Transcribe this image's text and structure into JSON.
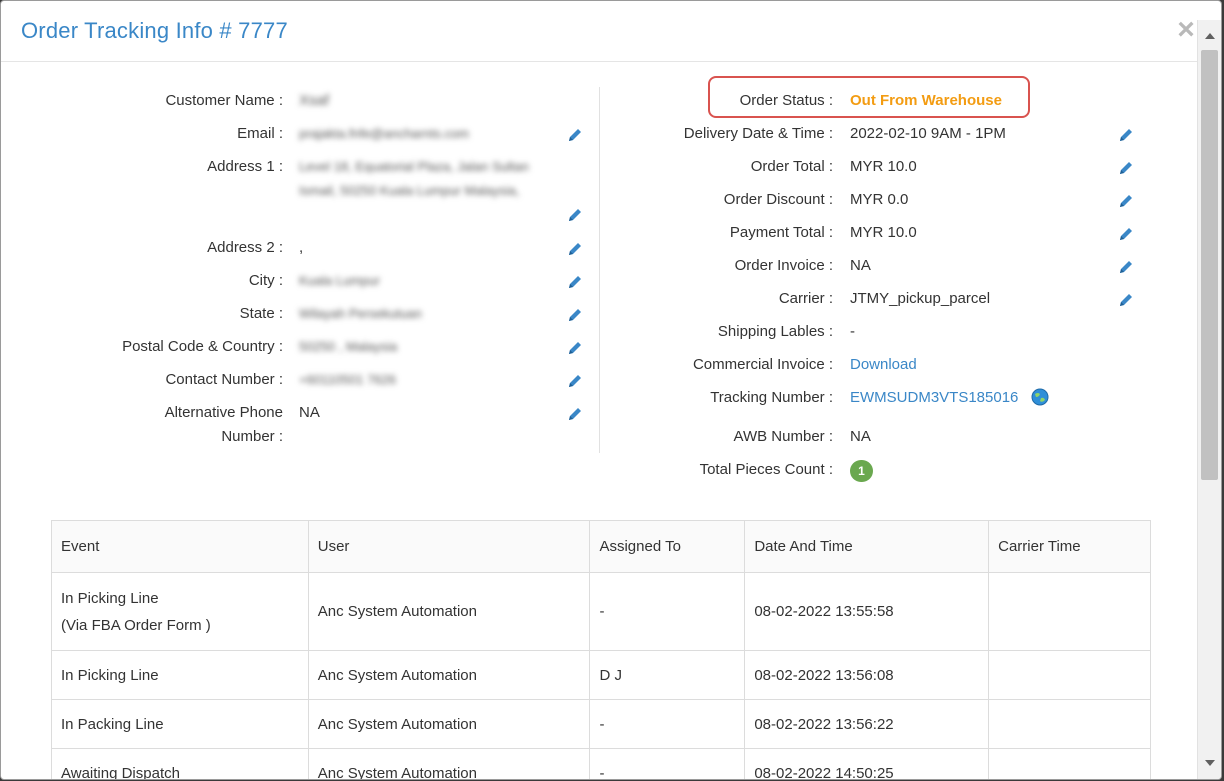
{
  "modal": {
    "title": "Order Tracking Info # 7777",
    "close_label": "×"
  },
  "left_fields": {
    "customer_name": {
      "label": "Customer Name :",
      "value": "Xsaf"
    },
    "email": {
      "label": "Email :",
      "value": "prajakta.fnfe@ancharnts.com"
    },
    "address1": {
      "label": "Address 1 :",
      "line1": "Level 18, Equatorial Plaza, Jalan Sultan",
      "line2": "Ismail, 50250 Kuala Lumpur Malaysia,"
    },
    "address2": {
      "label": "Address 2 :",
      "value": ","
    },
    "city": {
      "label": "City :",
      "value": "Kuala Lumpur"
    },
    "state": {
      "label": "State :",
      "value": "Wilayah Persekutuan"
    },
    "postal": {
      "label": "Postal Code & Country :",
      "value": "50250 , Malaysia"
    },
    "contact": {
      "label": "Contact Number :",
      "value": "+60110501 7626"
    },
    "alt_phone": {
      "label_line1": "Alternative Phone",
      "label_line2": "Number :",
      "value": "NA"
    }
  },
  "right_fields": {
    "order_status": {
      "label": "Order Status :",
      "value": "Out From Warehouse"
    },
    "delivery": {
      "label": "Delivery Date & Time :",
      "value": "2022-02-10 9AM - 1PM"
    },
    "order_total": {
      "label": "Order Total :",
      "value": "MYR 10.0"
    },
    "order_discount": {
      "label": "Order Discount :",
      "value": "MYR 0.0"
    },
    "payment_total": {
      "label": "Payment Total :",
      "value": "MYR 10.0"
    },
    "order_invoice": {
      "label": "Order Invoice :",
      "value": "NA"
    },
    "carrier": {
      "label": "Carrier :",
      "value": "JTMY_pickup_parcel"
    },
    "shipping_labels": {
      "label": "Shipping Lables :",
      "value": "-"
    },
    "commercial_invoice": {
      "label": "Commercial Invoice :",
      "value": "Download"
    },
    "tracking": {
      "label": "Tracking Number :",
      "value": "EWMSUDM3VTS185016"
    },
    "awb": {
      "label": "AWB Number :",
      "value": "NA"
    },
    "pieces": {
      "label": "Total Pieces Count :",
      "value": "1"
    }
  },
  "colors": {
    "title_blue": "#3a87c7",
    "status_orange": "#f39c12",
    "highlight_red": "#d9534f",
    "badge_green": "#6aa84f"
  },
  "table": {
    "headers": [
      "Event",
      "User",
      "Assigned To",
      "Date And Time",
      "Carrier Time"
    ],
    "rows": [
      {
        "event": "In Picking Line",
        "event_sub": "(Via FBA Order Form )",
        "user": "Anc System Automation",
        "assigned": "-",
        "datetime": "08-02-2022 13:55:58",
        "carrier_time": ""
      },
      {
        "event": "In Picking Line",
        "user": "Anc System Automation",
        "assigned": "D J",
        "datetime": "08-02-2022 13:56:08",
        "carrier_time": ""
      },
      {
        "event": "In Packing Line",
        "user": "Anc System Automation",
        "assigned": "-",
        "datetime": "08-02-2022 13:56:22",
        "carrier_time": ""
      },
      {
        "event": "Awaiting Dispatch",
        "user": "Anc System Automation",
        "assigned": "-",
        "datetime": "08-02-2022 14:50:25",
        "carrier_time": ""
      }
    ]
  }
}
